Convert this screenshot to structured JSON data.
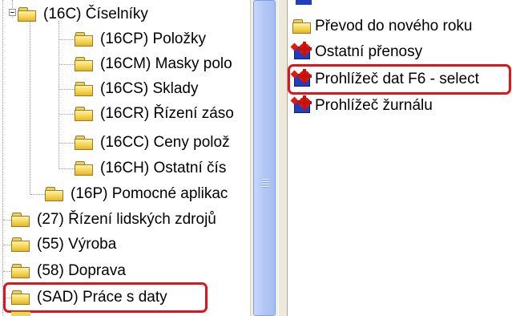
{
  "tree": {
    "items": [
      {
        "label": "(16C) Číselníky",
        "icon": "folder-icon",
        "expander": "minus"
      },
      {
        "label": "(16CP) Položky",
        "icon": "folder-icon"
      },
      {
        "label": "(16CM) Masky polo",
        "icon": "folder-icon"
      },
      {
        "label": "(16CS) Sklady",
        "icon": "folder-icon"
      },
      {
        "label": "(16CR) Řízení záso",
        "icon": "folder-icon"
      },
      {
        "label": "(16CC) Ceny polož",
        "icon": "folder-icon"
      },
      {
        "label": "(16CH) Ostatní čís",
        "icon": "folder-icon"
      },
      {
        "label": "(16P) Pomocné aplikac",
        "icon": "folder-icon"
      },
      {
        "label": "(27) Řízení lidských zdrojů",
        "icon": "folder-icon"
      },
      {
        "label": "(55) Výroba",
        "icon": "folder-icon"
      },
      {
        "label": "(58) Doprava",
        "icon": "folder-icon"
      },
      {
        "label": "(SAD) Práce s daty",
        "icon": "folder-icon",
        "highlighted": true
      }
    ]
  },
  "list": {
    "items": [
      {
        "label": "Převod do nového roku",
        "icon": "folder-icon"
      },
      {
        "label": "Ostatní přenosy",
        "icon": "gear-icon"
      },
      {
        "label": "Prohlížeč dat F6 - select",
        "icon": "gear-icon",
        "highlighted": true
      },
      {
        "label": "Prohlížeč žurnálu",
        "icon": "gear-icon"
      }
    ]
  },
  "colors": {
    "highlight": "#e0141b",
    "scroll_thumb": "#b4c8f6",
    "folder": "#f4d24f"
  }
}
